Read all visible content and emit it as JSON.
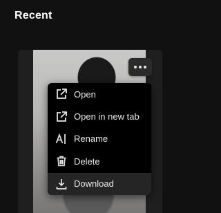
{
  "section": {
    "title": "Recent"
  },
  "menu": {
    "items": [
      {
        "label": "Open",
        "icon": "external-link-icon"
      },
      {
        "label": "Open in new tab",
        "icon": "new-tab-icon"
      },
      {
        "label": "Rename",
        "icon": "rename-icon"
      },
      {
        "label": "Delete",
        "icon": "trash-icon"
      },
      {
        "label": "Download",
        "icon": "download-icon"
      }
    ],
    "hovered_index": 4
  },
  "colors": {
    "background": "#111111",
    "menu_background": "#000000",
    "menu_hover": "#252525",
    "text": "#ececec"
  }
}
